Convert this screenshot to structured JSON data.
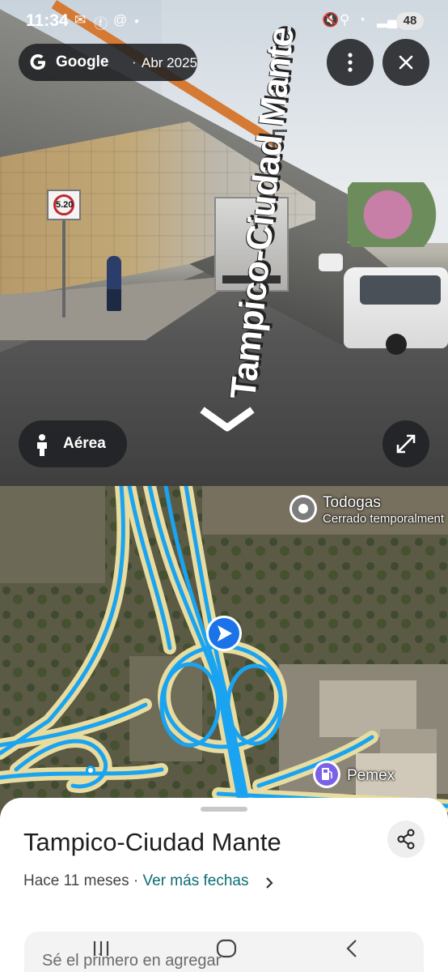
{
  "status_bar": {
    "time": "11:34",
    "battery": "48"
  },
  "street_view": {
    "provider": "Google",
    "date_sep": "·",
    "date": "Abr 2025",
    "road_label": "Tampico-Ciudad Mante",
    "sign_text": "5.20",
    "aerea_label": "Aérea"
  },
  "map": {
    "poi": [
      {
        "name": "Todogas",
        "status": "Cerrado temporalment"
      },
      {
        "name": "Pemex"
      }
    ]
  },
  "sheet": {
    "title": "Tampico-Ciudad Mante",
    "subtitle_age": "Hace 11 meses",
    "subtitle_sep": "·",
    "subtitle_link": "Ver más fechas",
    "card_text": "Sé el primero en agregar"
  },
  "colors": {
    "route_blue": "#1aa3f0",
    "road_beige": "#e8dca0",
    "link_teal": "#0b6c72",
    "pill_bg": "#202124"
  },
  "icons": {
    "more": "more-vert-icon",
    "close": "close-icon",
    "pegman": "pegman-icon",
    "expand": "expand-icon",
    "share": "share-icon",
    "location_arrow": "navigation-arrow-icon"
  }
}
